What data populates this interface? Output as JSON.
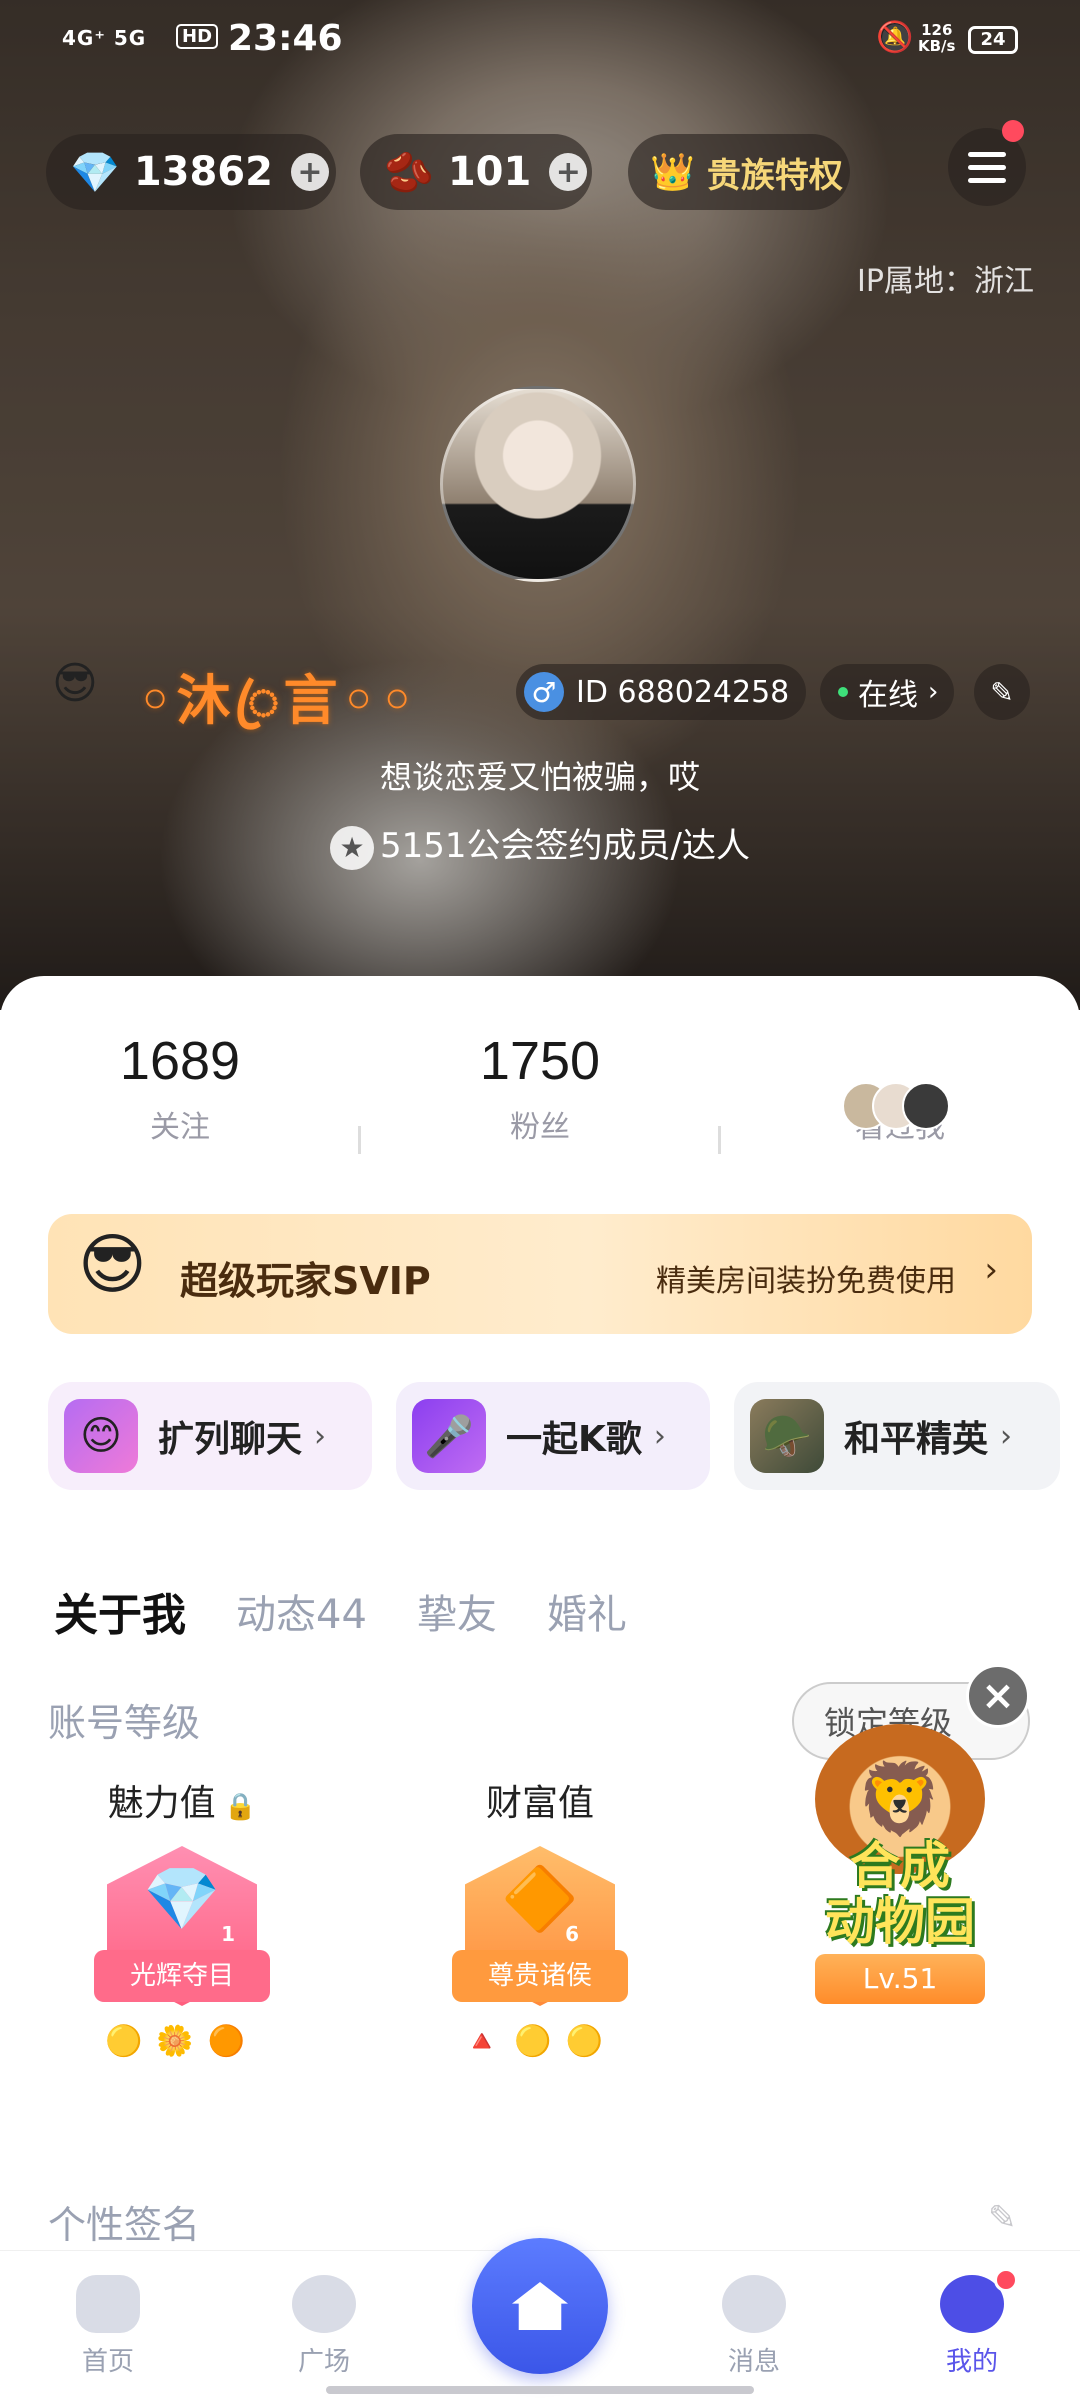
{
  "status_bar": {
    "signal": "4G⁺ 5G",
    "hd": "HD",
    "time": "23:46",
    "net_speed": "126\nKB/s",
    "battery": "24"
  },
  "header": {
    "gems": "13862",
    "beans": "101",
    "noble_label": "贵族特权",
    "ip_location": "IP属地：浙江"
  },
  "profile": {
    "nickname": "◦沐ꦿ言◦◦",
    "user_id": "ID 688024258",
    "status": "在线",
    "motto": "想谈恋爱又怕被骗，哎",
    "guild": "5151公会签约成员/达人"
  },
  "stats": [
    {
      "value": "1689",
      "label": "关注"
    },
    {
      "value": "1750",
      "label": "粉丝"
    },
    {
      "label": "看过我"
    }
  ],
  "svip": {
    "title": "超级玩家SVIP",
    "desc": "精美房间装扮免费使用"
  },
  "quick_links": [
    {
      "label": "扩列聊天"
    },
    {
      "label": "一起K歌"
    },
    {
      "label": "和平精英"
    }
  ],
  "tabs": [
    "关于我",
    "动态44",
    "挚友",
    "婚礼"
  ],
  "account_level": {
    "title": "账号等级",
    "lock_button": "锁定等级",
    "charm": {
      "name": "魅力值",
      "rank": "光辉夺目",
      "level": "1"
    },
    "wealth": {
      "name": "财富值",
      "rank": "尊贵诸侯",
      "level": "6"
    },
    "zoo": {
      "title": "合成\n动物园",
      "level": "Lv.51"
    }
  },
  "signature": {
    "title": "个性签名"
  },
  "bottom_nav": {
    "home": "首页",
    "plaza": "广场",
    "messages": "消息",
    "mine": "我的"
  },
  "colors": {
    "accent": "#4d4ee6",
    "nickname": "#ff8a2a",
    "badge_red": "#ff4a5e"
  }
}
